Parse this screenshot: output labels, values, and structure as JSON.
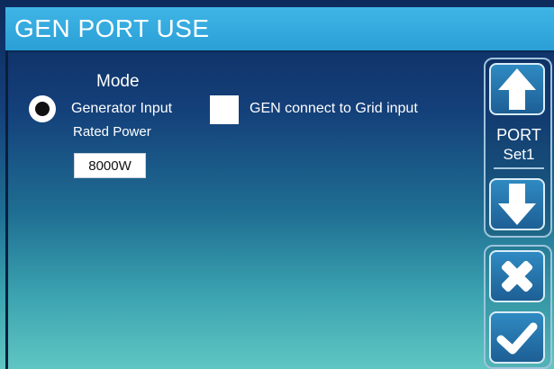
{
  "header": {
    "title": "GEN PORT USE"
  },
  "mode": {
    "label": "Mode",
    "generator_input_label": "Generator Input",
    "generator_input_selected": true,
    "grid_input_label": "GEN connect to Grid input",
    "grid_input_checked": false
  },
  "rated_power": {
    "label": "Rated Power",
    "value": "8000W"
  },
  "side_panel": {
    "port_label": "PORT",
    "set_label": "Set1",
    "up_icon": "arrow-up-icon",
    "down_icon": "arrow-down-icon",
    "cancel_icon": "close-icon",
    "confirm_icon": "check-icon"
  },
  "colors": {
    "title_bar": "#2a9fd6",
    "background_top": "#0d2a5c",
    "background_bottom": "#5fc6c3",
    "button": "#1d5f95",
    "text": "#ffffff"
  }
}
